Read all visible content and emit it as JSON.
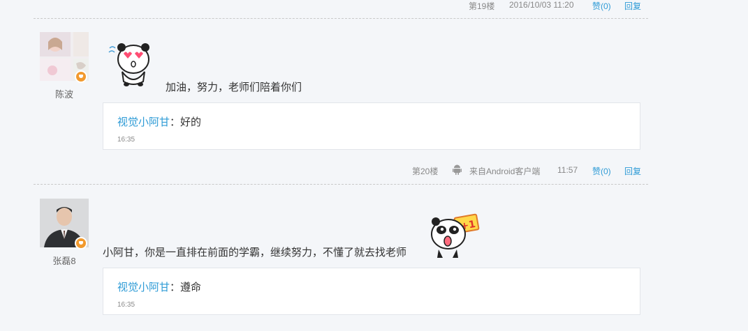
{
  "floor19": {
    "floor": "第19楼",
    "datetime": "2016/10/03 11:20",
    "like": "赞(0)",
    "reply": "回复"
  },
  "floor20": {
    "user": "陈波",
    "content": "加油，努力，老师们陪着你们",
    "reply_author": "视觉小阿甘",
    "reply_sep": "：",
    "reply_body": "好的",
    "reply_time": "16:35",
    "floor": "第20楼",
    "client_icon": "android-icon",
    "client": "来自Android客户端",
    "time": "11:57",
    "like": "赞(0)",
    "reply": "回复"
  },
  "floor21": {
    "user": "张磊8",
    "content": "小阿甘，你是一直排在前面的学霸，继续努力，不懂了就去找老师",
    "reply_author": "视觉小阿甘",
    "reply_sep": "：",
    "reply_body": "遵命",
    "reply_time": "16:35"
  },
  "colors": {
    "link": "#2e9bd6",
    "badge": "#f29a2e",
    "background": "#f4f6f9"
  }
}
